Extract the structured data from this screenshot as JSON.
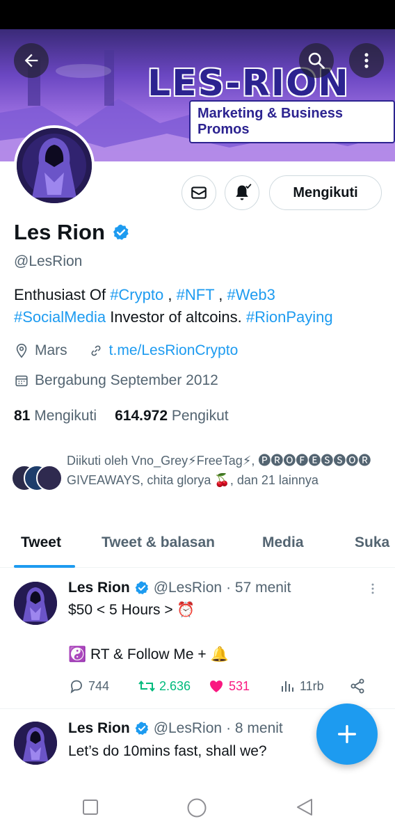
{
  "colors": {
    "accent": "#1d9bf0",
    "text_primary": "#0f1419",
    "text_secondary": "#536471",
    "retweet_green": "#00ba7c",
    "like_pink": "#f91880",
    "banner_purple": "#6b47c2"
  },
  "header": {
    "back_icon": "arrow-left-icon",
    "search_icon": "search-icon",
    "more_icon": "more-vertical-icon"
  },
  "banner": {
    "logo_text": "LES-RION",
    "tagline": "Marketing & Business Promos"
  },
  "profile": {
    "name": "Les Rion",
    "verified_icon": "verified-badge-icon",
    "handle": "@LesRion",
    "bio_line1_plain": "Enthusiast Of ",
    "bio_tag_crypto": "#Crypto",
    "bio_sep1": " , ",
    "bio_tag_nft": "#NFT",
    "bio_sep2": " , ",
    "bio_tag_web3": "#Web3",
    "bio_tag_socialmedia": "#SocialMedia",
    "bio_line2_plain": " Investor of altcoins. ",
    "bio_tag_rionpaying": "#RionPaying",
    "location": "Mars",
    "website": "t.me/LesRionCrypto",
    "joined": "Bergabung September 2012",
    "following_count": "81",
    "following_label": "Mengikuti",
    "followers_count": "614.972",
    "followers_label": "Pengikut"
  },
  "actions": {
    "message_icon": "mail-icon",
    "notify_icon": "bell-check-icon",
    "follow_label": "Mengikuti"
  },
  "followed_by": {
    "text": "Diikuti oleh Vno_Grey⚡FreeTag⚡, 🅟🅡🅞🅕🅔🅢🅢🅞🅡 GIVEAWAYS, chita glorya 🍒, dan 21 lainnya"
  },
  "tabs": [
    {
      "label": "Tweet",
      "active": true
    },
    {
      "label": "Tweet & balasan",
      "active": false
    },
    {
      "label": "Media",
      "active": false
    },
    {
      "label": "Suka",
      "active": false
    }
  ],
  "tweets": [
    {
      "name": "Les Rion",
      "handle": "@LesRion",
      "time": "· 57 menit",
      "line1": "$50 < 5 Hours > ⏰",
      "line2": "☯️ RT & Follow Me + 🔔",
      "replies": "744",
      "retweets": "2.636",
      "likes": "531",
      "views": "11rb"
    },
    {
      "name": "Les Rion",
      "handle": "@LesRion",
      "time": "· 8 menit",
      "line1": "Let’s do 10mins fast, shall we?"
    }
  ],
  "fab": {
    "icon": "plus-icon"
  },
  "system_nav": {
    "recents": "square-icon",
    "home": "circle-icon",
    "back": "triangle-back-icon"
  }
}
